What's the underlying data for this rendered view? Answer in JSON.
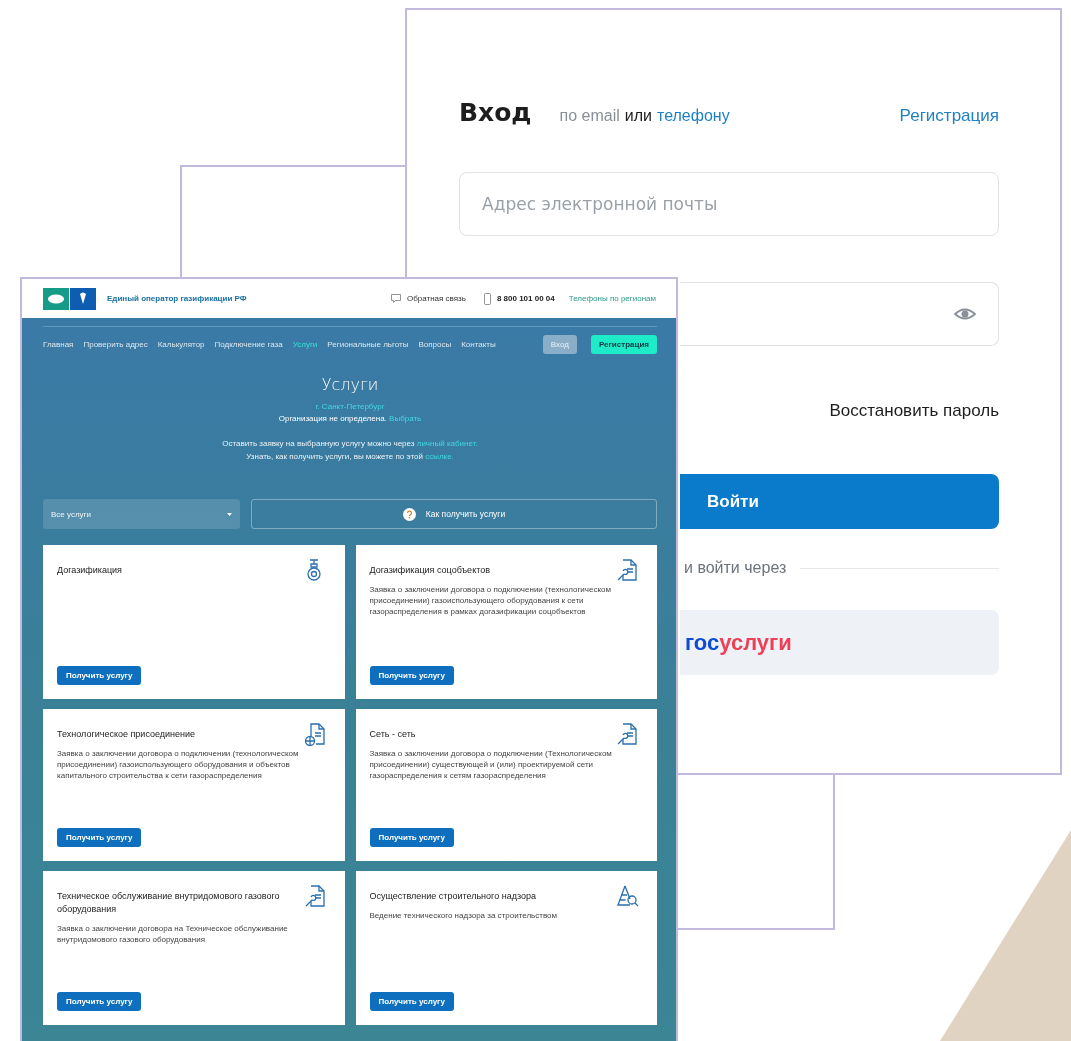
{
  "login_window": {
    "title": "Вход",
    "login_methods": [
      {
        "label": "по email",
        "selected": true
      },
      {
        "label": "телефону",
        "selected": false
      }
    ],
    "methods_separator": "или",
    "register_link": "Регистрация",
    "email_field": {
      "placeholder": "Адрес электронной почты"
    },
    "password_field": {
      "show_password_icon": true
    },
    "restore_link": "Восстановить пароль",
    "submit_button": "Войти",
    "alt_login_label": "и войти через",
    "gosuslugi_button": {
      "prefix": "гос",
      "suffix": "услуги"
    }
  },
  "site_window": {
    "logo_title": "Единый оператор газификации РФ",
    "feedback": "Обратная связь",
    "phone": "8 800 101 00 04",
    "regional_phones": "Телефоны по регионам",
    "nav": [
      {
        "label": "Главная",
        "selected": false
      },
      {
        "label": "Проверить адрес",
        "selected": false
      },
      {
        "label": "Калькулятор",
        "selected": false
      },
      {
        "label": "Подключение газа",
        "selected": false
      },
      {
        "label": "Услуги",
        "selected": true
      },
      {
        "label": "Региональные льготы",
        "selected": false
      },
      {
        "label": "Вопросы",
        "selected": false
      },
      {
        "label": "Контакты",
        "selected": false
      }
    ],
    "login_button": "Вход",
    "register_button": "Регистрация",
    "page_title": "Услуги",
    "city": "г. Санкт-Петербург",
    "organization_text": "Организация не определена.",
    "organization_link": "Выбрать",
    "info_lines": [
      {
        "text": "Оставить заявку на выбранную услугу можно через",
        "link": "личный кабинет."
      },
      {
        "text": "Узнать, как получить услуги, вы можете по этой",
        "link": "ссылке."
      }
    ],
    "filter_select": {
      "value": "Все услуги"
    },
    "help_button": "Как получить услуги",
    "cards": [
      {
        "kind": "valve",
        "title": "Догазификация",
        "button": "Получить услугу"
      },
      {
        "kind": "repair",
        "title": "Догазификация соцобъектов",
        "description": "Заявка о заключении договора о подключении (технологическом присоединении) газоиспользующего оборудования к сети газораспределения в рамках догазификации соцобъектов",
        "button": "Получить услугу"
      },
      {
        "kind": "connection",
        "title": "Технологическое присоединение",
        "description": "Заявка о заключении договора о подключении (технологическом присоединении) газоиспользующего оборудования и объектов капитального строительства к сети газораспределения",
        "button": "Получить услугу"
      },
      {
        "kind": "repair",
        "title": "Сеть - сеть",
        "description": "Заявка о заключении договора о подключении (Технологическом присоединении) существующей и (или) проектируемой сети газораспределения к сетям газораспределения",
        "button": "Получить услугу"
      },
      {
        "kind": "repair",
        "title": "Техническое обслуживание внутридомового газового оборудования",
        "description": "Заявка о заключении договора на Техническое обслуживание внутридомового газового оборудования",
        "button": "Получить услугу"
      },
      {
        "kind": "supervision",
        "title": "Осуществление строительного надзора",
        "description": "Ведение технического надзора за строительством",
        "button": "Получить услугу"
      }
    ]
  }
}
